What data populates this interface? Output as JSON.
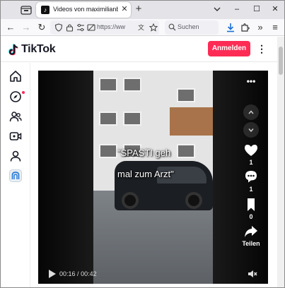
{
  "browser": {
    "tab_title": "Videos von maximilianbaehring",
    "tab_close": "✕",
    "new_tab": "+",
    "url_display": "https://www.ti",
    "search_placeholder": "Suchen",
    "window_controls": {
      "minimize": "–",
      "maximize": "☐",
      "close": "✕"
    }
  },
  "header": {
    "logo_text": "TikTok",
    "login_label": "Anmelden",
    "more_label": "⋮"
  },
  "sidenav": {
    "items": [
      "home-icon",
      "explore-icon",
      "following-icon",
      "live-icon",
      "profile-icon",
      "more-apps-icon"
    ]
  },
  "video": {
    "overlay_line1": "\"SPASTI geh",
    "overlay_line2": "mal zum Arzt\"",
    "like_count": "1",
    "comment_count": "1",
    "save_count": "0",
    "share_label": "Teilen",
    "time_current": "00:16",
    "time_separator": "/",
    "time_total": "00:42",
    "more_label": "•••"
  },
  "colors": {
    "brand_red": "#fe2c55",
    "text_dark": "#161823"
  }
}
